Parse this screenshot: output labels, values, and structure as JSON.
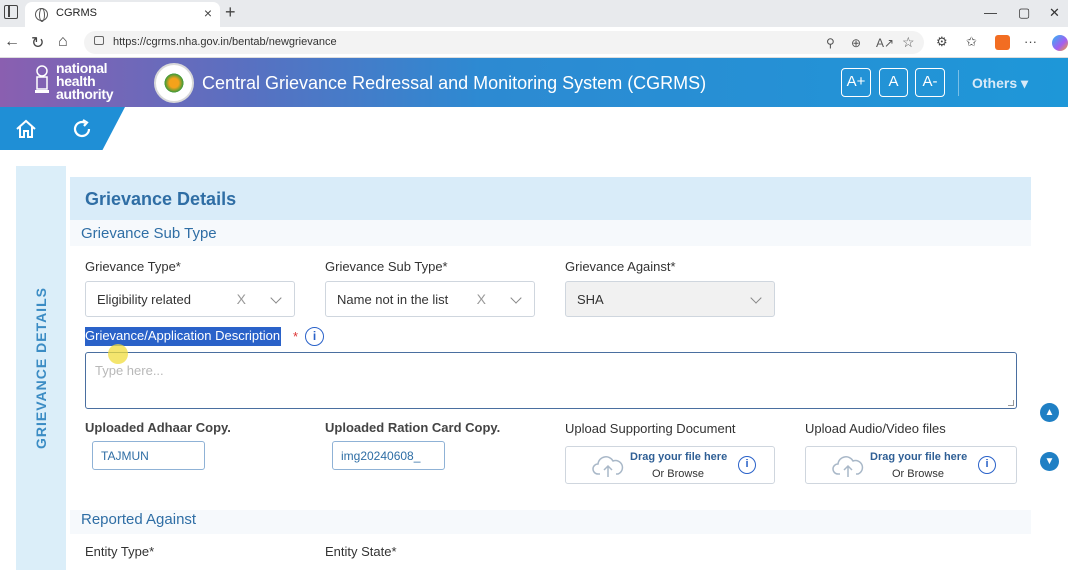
{
  "browser": {
    "tab_title": "CGRMS",
    "tab_close": "×",
    "new_tab": "+",
    "url": "https://cgrms.nha.gov.in/bentab/newgrievance",
    "window_controls": {
      "minimize": "—",
      "maximize": "▢",
      "close": "✕"
    },
    "nav": {
      "back": "←",
      "reload": "↻",
      "home": "⌂"
    },
    "url_icons": {
      "location": "⚲",
      "zoom": "⊕",
      "read_aloud": "A↗",
      "favorite": "☆"
    },
    "toolbar_icons": {
      "extensions": "⚙",
      "favorites": "✩",
      "more": "···"
    }
  },
  "header": {
    "logo_text_1": "national",
    "logo_text_2": "health",
    "logo_text_3": "authority",
    "title": "Central Grievance Redressal and Monitoring System (CGRMS)",
    "font_increase": "A+",
    "font_normal": "A",
    "font_decrease": "A-",
    "others": "Others ▾"
  },
  "side": {
    "label": "GRIEVANCE DETAILS"
  },
  "form": {
    "card_title": "Grievance Details",
    "section_subtype": "Grievance Sub Type",
    "grievance_type": {
      "label": "Grievance Type*",
      "value": "Eligibility related"
    },
    "grievance_sub_type": {
      "label": "Grievance Sub Type*",
      "value": "Name not in the list"
    },
    "grievance_against": {
      "label": "Grievance Against*",
      "value": "SHA"
    },
    "clear_icon": "X",
    "description": {
      "label": "Grievance/Application Description",
      "required": "*",
      "placeholder": "Type here..."
    },
    "info": "i",
    "uploaded_adhaar": {
      "label": "Uploaded Adhaar Copy.",
      "value": "TAJMUN"
    },
    "uploaded_ration": {
      "label": "Uploaded Ration Card Copy.",
      "value": "img20240608_"
    },
    "upload_supporting": {
      "label": "Upload Supporting Document",
      "drag": "Drag your file here",
      "browse": "Or Browse"
    },
    "upload_av": {
      "label": "Upload Audio/Video files",
      "drag": "Drag your file here",
      "browse": "Or Browse"
    },
    "section_reported": "Reported Against",
    "entity_type": {
      "label": "Entity Type*"
    },
    "entity_state": {
      "label": "Entity State*"
    }
  },
  "scroll": {
    "up": "▲",
    "down": "▼"
  }
}
